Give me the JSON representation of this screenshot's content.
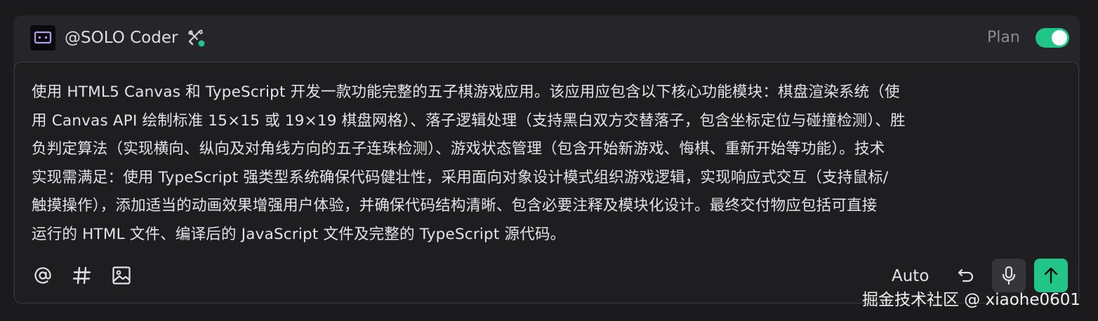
{
  "header": {
    "agent_name": "@SOLO Coder",
    "agent_icon": "robot-face-icon",
    "tools_icon": "wrench-screwdriver-icon",
    "status_color": "#21c588",
    "plan_label": "Plan",
    "plan_enabled": true
  },
  "prompt": {
    "lines": [
      "使用 HTML5 Canvas 和 TypeScript 开发一款功能完整的五子棋游戏应用。该应用应包含以下核心功能模块：棋盘渲染系统（使",
      "用 Canvas API 绘制标准 15×15 或 19×19 棋盘网格）、落子逻辑处理（支持黑白双方交替落子，包含坐标定位与碰撞检测）、胜",
      "负判定算法（实现横向、纵向及对角线方向的五子连珠检测）、游戏状态管理（包含开始新游戏、悔棋、重新开始等功能）。技术",
      "实现需满足：使用 TypeScript 强类型系统确保代码健壮性，采用面向对象设计模式组织游戏逻辑，实现响应式交互（支持鼠标/",
      "触摸操作），添加适当的动画效果增强用户体验，并确保代码结构清晰、包含必要注释及模块化设计。最终交付物应包括可直接",
      "运行的 HTML 文件、编译后的 JavaScript 文件及完整的 TypeScript 源代码。"
    ]
  },
  "toolbar": {
    "mention_icon": "at-sign-icon",
    "hash_icon": "hash-icon",
    "image_icon": "image-icon",
    "mode_label": "Auto",
    "undo_icon": "undo-icon",
    "mic_icon": "microphone-icon",
    "send_icon": "arrow-up-icon"
  },
  "watermark": "掘金技术社区 @ xiaohe0601",
  "colors": {
    "accent": "#21c588",
    "panel": "#26262a",
    "input": "#1e1e21",
    "background": "#1b1b1e"
  }
}
